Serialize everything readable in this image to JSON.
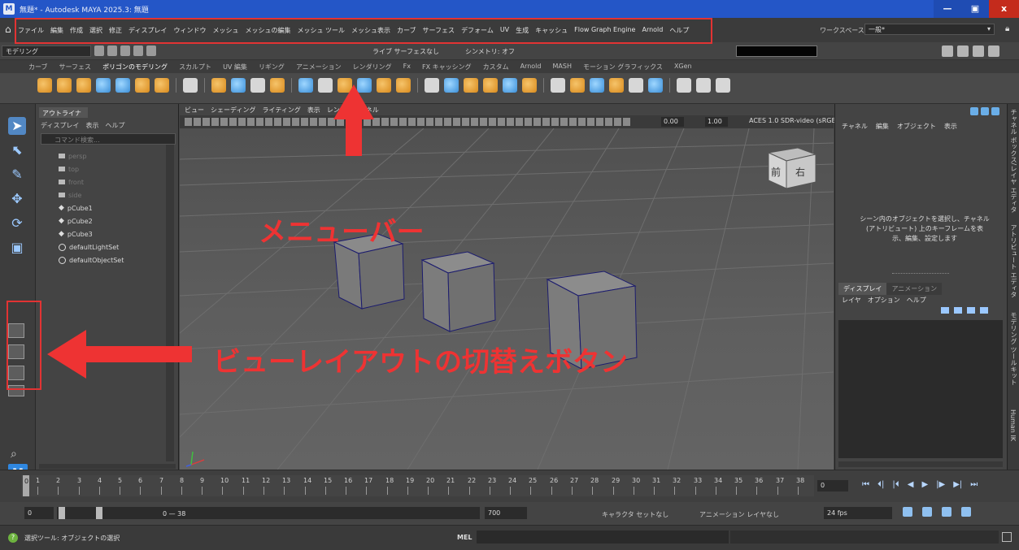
{
  "window": {
    "title": "無題* - Autodesk MAYA 2025.3: 無題",
    "minimize": "—",
    "maximize": "▣",
    "close": "x"
  },
  "menubar": {
    "items": [
      "ファイル",
      "編集",
      "作成",
      "選択",
      "修正",
      "ディスプレイ",
      "ウィンドウ",
      "メッシュ",
      "メッシュの編集",
      "メッシュ ツール",
      "メッシュ表示",
      "カーブ",
      "サーフェス",
      "デフォーム",
      "UV",
      "生成",
      "キャッシュ",
      "Flow Graph Engine",
      "Arnold",
      "ヘルプ"
    ],
    "workspace_label": "ワークスペース:",
    "workspace_value": "一般*"
  },
  "statusline": {
    "mode": "モデリング",
    "live_label": "ライブ サーフェスなし",
    "symmetry": "シンメトリ: オフ"
  },
  "shelf": {
    "tabs": [
      "カーブ",
      "サーフェス",
      "ポリゴンのモデリング",
      "スカルプト",
      "UV 編集",
      "リギング",
      "アニメーション",
      "レンダリング",
      "Fx",
      "FX キャッシング",
      "カスタム",
      "Arnold",
      "MASH",
      "モーション グラフィックス",
      "XGen"
    ],
    "active_tab": "ポリゴンのモデリング"
  },
  "outliner": {
    "tab": "アウトライナ",
    "menu": [
      "ディスプレイ",
      "表示",
      "ヘルプ"
    ],
    "search_placeholder": "コマンド検索...",
    "items": [
      {
        "label": "persp",
        "kind": "camera"
      },
      {
        "label": "top",
        "kind": "camera"
      },
      {
        "label": "front",
        "kind": "camera"
      },
      {
        "label": "side",
        "kind": "camera"
      },
      {
        "label": "pCube1",
        "kind": "mesh"
      },
      {
        "label": "pCube2",
        "kind": "mesh"
      },
      {
        "label": "pCube3",
        "kind": "mesh"
      },
      {
        "label": "defaultLightSet",
        "kind": "set"
      },
      {
        "label": "defaultObjectSet",
        "kind": "set"
      }
    ]
  },
  "viewport": {
    "menu": [
      "ビュー",
      "シェーディング",
      "ライティング",
      "表示",
      "レンダラ",
      "パネル"
    ],
    "exposure": "0.00",
    "gamma": "1.00",
    "colorspace": "ACES 1.0 SDR-video (sRGB)",
    "viewcube_front": "前",
    "viewcube_right": "右"
  },
  "channelbox": {
    "menu": [
      "チャネル",
      "編集",
      "オブジェクト",
      "表示"
    ],
    "message": "シーン内のオブジェクトを選択し、チャネル (アトリビュート) 上のキーフレームを表示、編集、設定します",
    "layer_tabs": [
      "ディスプレイ",
      "アニメーション"
    ],
    "layer_menu": [
      "レイヤ",
      "オプション",
      "ヘルプ"
    ]
  },
  "side_tabs": [
    "チャネル ボックス/レイヤ エディタ",
    "アトリビュート エディタ",
    "モデリング ツールキット",
    "Human IK"
  ],
  "timeline": {
    "ticks": [
      "1",
      "2",
      "3",
      "4",
      "5",
      "6",
      "7",
      "8",
      "9",
      "10",
      "11",
      "12",
      "13",
      "14",
      "15",
      "16",
      "17",
      "18",
      "19",
      "20",
      "21",
      "22",
      "23",
      "24",
      "25",
      "26",
      "27",
      "28",
      "29",
      "30",
      "31",
      "32",
      "33",
      "34",
      "35",
      "36",
      "37",
      "38"
    ],
    "current_frame": "0",
    "current_field": "0",
    "playback_controls": [
      "⏮",
      "⏴|",
      "|⏴",
      "◀",
      "▶",
      "|▶",
      "▶|",
      "⏭"
    ]
  },
  "range": {
    "start": "0",
    "range_label": "0 — 38",
    "end": "700",
    "character": "キャラクタ セットなし",
    "anim_layer": "アニメーション レイヤなし",
    "fps": "24 fps"
  },
  "helpline": {
    "help": "選択ツール: オブジェクトの選択",
    "mel": "MEL"
  },
  "annotations": {
    "menubar_label": "メニューバー",
    "layout_label": "ビューレイアウトの切替えボタン",
    "color": "#ee3333"
  }
}
